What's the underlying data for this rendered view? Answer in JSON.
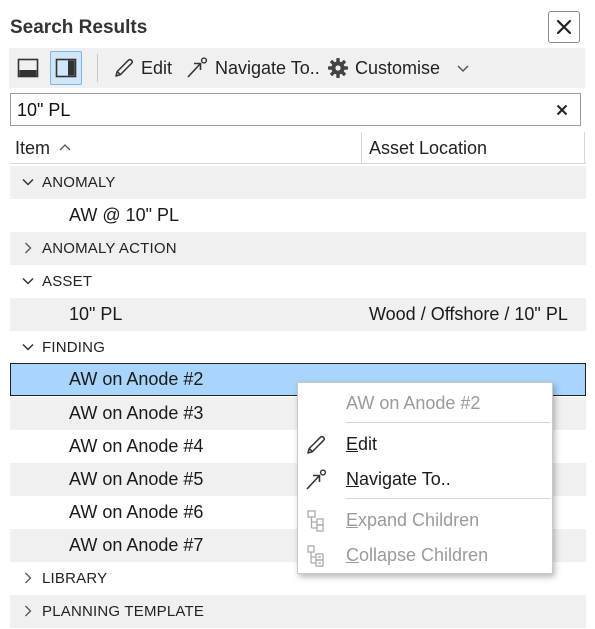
{
  "panel": {
    "title": "Search Results",
    "close_icon": "close-icon"
  },
  "toolbar": {
    "layout_bottom_icon": "panel-bottom-icon",
    "layout_right_icon": "panel-right-icon",
    "edit_label": "Edit",
    "edit_icon": "pencil-icon",
    "navigate_label": "Navigate To..",
    "navigate_icon": "navigate-arrow-icon",
    "customise_label": "Customise",
    "customise_icon": "gear-icon",
    "more_icon": "chevron-down-icon"
  },
  "search": {
    "value": "10\" PL",
    "clear_icon": "clear-x-icon"
  },
  "columns": {
    "item": "Item",
    "item_sort": "ascending",
    "location": "Asset Location"
  },
  "rows": [
    {
      "type": "group",
      "label": "ANOMALY",
      "expanded": true
    },
    {
      "type": "item",
      "label": "AW @ 10\" PL",
      "location": ""
    },
    {
      "type": "group",
      "label": "ANOMALY ACTION",
      "expanded": false
    },
    {
      "type": "group",
      "label": "ASSET",
      "expanded": true
    },
    {
      "type": "item",
      "label": "10\" PL",
      "location": "Wood / Offshore / 10\" PL"
    },
    {
      "type": "group",
      "label": "FINDING",
      "expanded": true
    },
    {
      "type": "item",
      "label": "AW on Anode #2",
      "location": "",
      "selected": true
    },
    {
      "type": "item",
      "label": "AW on Anode #3",
      "location": ""
    },
    {
      "type": "item",
      "label": "AW on Anode #4",
      "location": ""
    },
    {
      "type": "item",
      "label": "AW on Anode #5",
      "location": ""
    },
    {
      "type": "item",
      "label": "AW on Anode #6",
      "location": ""
    },
    {
      "type": "item",
      "label": "AW on Anode #7",
      "location": ""
    },
    {
      "type": "group",
      "label": "LIBRARY",
      "expanded": false
    },
    {
      "type": "group",
      "label": "PLANNING TEMPLATE",
      "expanded": false
    }
  ],
  "context_menu": {
    "header": "AW on Anode #2",
    "edit": {
      "mnemonic": "E",
      "rest": "dit",
      "icon": "pencil-icon",
      "enabled": true
    },
    "navigate": {
      "mnemonic": "N",
      "rest": "avigate To..",
      "icon": "navigate-arrow-icon",
      "enabled": true
    },
    "expand": {
      "mnemonic": "E",
      "rest": "xpand Children",
      "icon": "expand-tree-icon",
      "enabled": false
    },
    "collapse": {
      "mnemonic": "C",
      "rest": "ollapse Children",
      "icon": "collapse-tree-icon",
      "enabled": false
    }
  },
  "colors": {
    "selection": "#a9d4fb",
    "alt_row": "#f0f0f0",
    "toolbar_bg": "#f0f0f0",
    "active_toggle": "#cfe6fb",
    "disabled_text": "#9a9a9a"
  }
}
